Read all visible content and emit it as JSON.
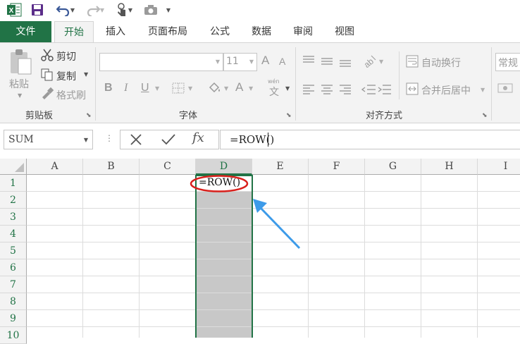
{
  "qat": {
    "icons": [
      "excel-logo-icon",
      "save-icon",
      "undo-icon",
      "redo-icon",
      "touch-mode-icon",
      "camera-icon",
      "customize-caret-icon"
    ]
  },
  "tabs": [
    "文件",
    "开始",
    "插入",
    "页面布局",
    "公式",
    "数据",
    "审阅",
    "视图"
  ],
  "ribbon": {
    "clipboard": {
      "paste": "粘贴",
      "cut": "剪切",
      "copy": "复制",
      "format_painter": "格式刷",
      "label": "剪贴板"
    },
    "font": {
      "size": "11",
      "grow": "A",
      "shrink": "A",
      "bold": "B",
      "italic": "I",
      "underline": "U",
      "font_color": "A",
      "phonetic_top": "wén",
      "phonetic_main": "文",
      "label": "字体"
    },
    "alignment": {
      "wrap_text": "自动换行",
      "merge_center": "合并后居中",
      "label": "对齐方式"
    },
    "number": {
      "format": "常规"
    }
  },
  "formula_bar": {
    "name_box": "SUM",
    "fx": "fx",
    "content": "=ROW()"
  },
  "grid": {
    "columns": [
      "A",
      "B",
      "C",
      "D",
      "E",
      "F",
      "G",
      "H",
      "I"
    ],
    "rows": [
      "1",
      "2",
      "3",
      "4",
      "5",
      "6",
      "7",
      "8",
      "9",
      "10"
    ],
    "selected_column": "D",
    "cell_D1": "=ROW()"
  },
  "colors": {
    "excel_green": "#217346",
    "selection_gray": "#c8c8c8",
    "annotation_red": "#d9201c",
    "annotation_arrow": "#3d9be9"
  }
}
